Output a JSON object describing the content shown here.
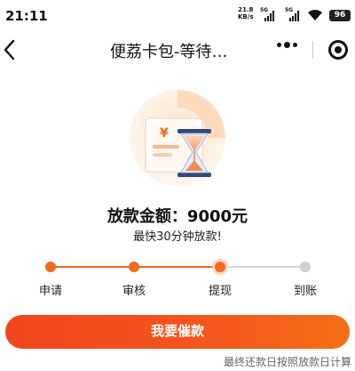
{
  "status_bar": {
    "time": "21:11",
    "net_speed_value": "21.8",
    "net_speed_unit": "KB/s",
    "sim1_label": "5G",
    "sim2_label": "5G",
    "battery": "96"
  },
  "nav": {
    "title": "便荔卡包-等待…",
    "back_icon": "chevron-left-icon",
    "more_icon": "more-dots-icon",
    "close_icon": "target-circle-icon"
  },
  "main": {
    "amount_text": "放款金额：9000元",
    "subtitle": "最快30分钟放款!",
    "steps": [
      {
        "label": "申请",
        "state": "done"
      },
      {
        "label": "审核",
        "state": "done"
      },
      {
        "label": "提现",
        "state": "current"
      },
      {
        "label": "到账",
        "state": "pending"
      }
    ],
    "cta_label": "我要催款",
    "footnote": "最终还款日按照放款日计算",
    "illustration": {
      "bill_symbol": "¥"
    }
  },
  "colors": {
    "accent": "#f26b1d",
    "button_start": "#f2461e",
    "button_end": "#f46f17",
    "pending": "#cfcfcf"
  }
}
